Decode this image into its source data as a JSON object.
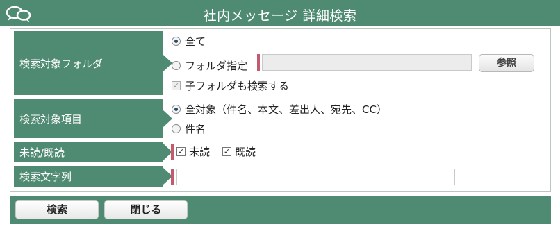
{
  "header": {
    "title": "社内メッセージ 詳細検索"
  },
  "icons": {
    "logo": "speech-bubbles-icon"
  },
  "colors": {
    "accent": "#4f8a72",
    "marker": "#c45a6e"
  },
  "folder": {
    "label": "検索対象フォルダ",
    "all": "全て",
    "specify": "フォルダ指定",
    "folder_value": "",
    "browse": "参照",
    "include_sub": "子フォルダも検索する"
  },
  "items": {
    "label": "検索対象項目",
    "all_targets": "全対象（件名、本文、差出人、宛先、CC）",
    "subject": "件名"
  },
  "read_state": {
    "label": "未読/既読",
    "unread": "未読",
    "read": "既読"
  },
  "search_text": {
    "label": "検索文字列",
    "value": ""
  },
  "footer": {
    "search": "検索",
    "close": "閉じる"
  }
}
